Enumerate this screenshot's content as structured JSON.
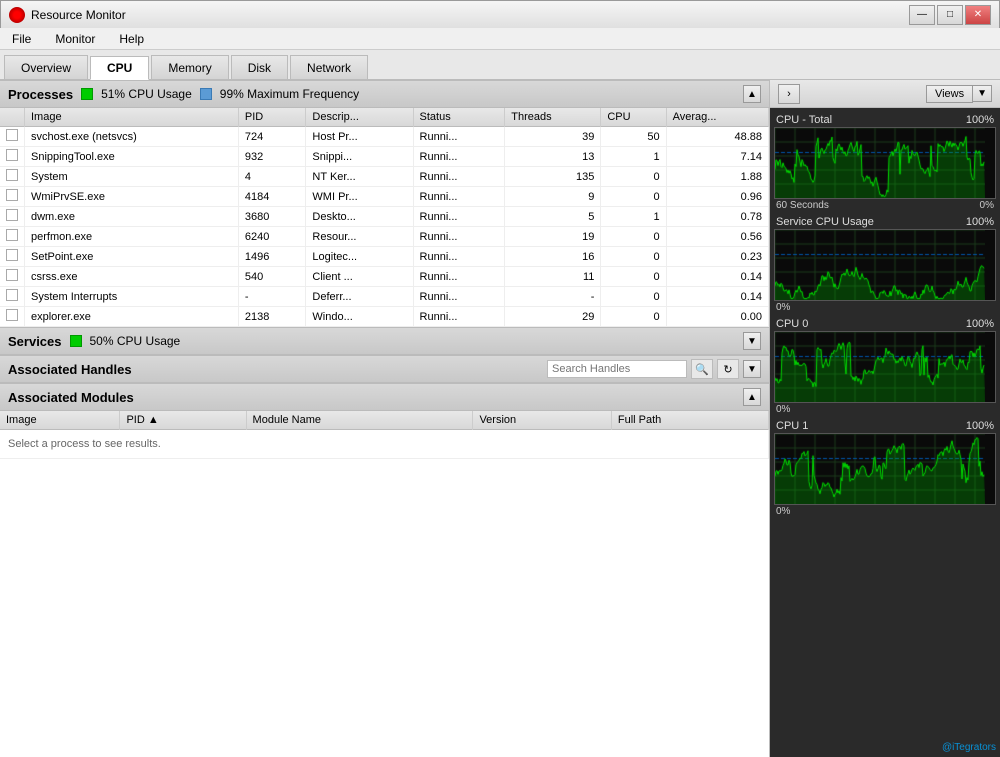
{
  "titleBar": {
    "icon": "resource-monitor-icon",
    "title": "Resource Monitor",
    "minBtn": "—",
    "maxBtn": "□",
    "closeBtn": "✕"
  },
  "menuBar": {
    "items": [
      "File",
      "Monitor",
      "Help"
    ]
  },
  "tabs": [
    {
      "label": "Overview",
      "active": false
    },
    {
      "label": "CPU",
      "active": true
    },
    {
      "label": "Memory",
      "active": false
    },
    {
      "label": "Disk",
      "active": false
    },
    {
      "label": "Network",
      "active": false
    }
  ],
  "processes": {
    "sectionTitle": "Processes",
    "cpuUsage": "51% CPU Usage",
    "maxFreq": "99% Maximum Frequency",
    "columns": [
      "Image",
      "PID",
      "Descrip...",
      "Status",
      "Threads",
      "CPU",
      "Averag..."
    ],
    "rows": [
      {
        "image": "svchost.exe (netsvcs)",
        "pid": "724",
        "desc": "Host Pr...",
        "status": "Runni...",
        "threads": "39",
        "cpu": "50",
        "avg": "48.88"
      },
      {
        "image": "SnippingTool.exe",
        "pid": "932",
        "desc": "Snippi...",
        "status": "Runni...",
        "threads": "13",
        "cpu": "1",
        "avg": "7.14"
      },
      {
        "image": "System",
        "pid": "4",
        "desc": "NT Ker...",
        "status": "Runni...",
        "threads": "135",
        "cpu": "0",
        "avg": "1.88"
      },
      {
        "image": "WmiPrvSE.exe",
        "pid": "4184",
        "desc": "WMI Pr...",
        "status": "Runni...",
        "threads": "9",
        "cpu": "0",
        "avg": "0.96"
      },
      {
        "image": "dwm.exe",
        "pid": "3680",
        "desc": "Deskto...",
        "status": "Runni...",
        "threads": "5",
        "cpu": "1",
        "avg": "0.78"
      },
      {
        "image": "perfmon.exe",
        "pid": "6240",
        "desc": "Resour...",
        "status": "Runni...",
        "threads": "19",
        "cpu": "0",
        "avg": "0.56"
      },
      {
        "image": "SetPoint.exe",
        "pid": "1496",
        "desc": "Logitec...",
        "status": "Runni...",
        "threads": "16",
        "cpu": "0",
        "avg": "0.23"
      },
      {
        "image": "csrss.exe",
        "pid": "540",
        "desc": "Client ...",
        "status": "Runni...",
        "threads": "11",
        "cpu": "0",
        "avg": "0.14"
      },
      {
        "image": "System Interrupts",
        "pid": "-",
        "desc": "Deferr...",
        "status": "Runni...",
        "threads": "-",
        "cpu": "0",
        "avg": "0.14"
      },
      {
        "image": "explorer.exe",
        "pid": "2138",
        "desc": "Windo...",
        "status": "Runni...",
        "threads": "29",
        "cpu": "0",
        "avg": "0.00"
      }
    ]
  },
  "services": {
    "sectionTitle": "Services",
    "cpuUsage": "50% CPU Usage"
  },
  "handles": {
    "sectionTitle": "Associated Handles",
    "searchPlaceholder": "Search Handles"
  },
  "modules": {
    "sectionTitle": "Associated Modules",
    "columns": [
      "Image",
      "PID",
      "Module Name",
      "Version",
      "Full Path"
    ],
    "emptyMessage": "Select a process to see results."
  },
  "rightPanel": {
    "navBtn": "›",
    "viewsLabel": "Views",
    "graphs": [
      {
        "label": "CPU - Total",
        "pct100": "100%",
        "footer60sec": "60 Seconds",
        "footerVal": "0%"
      },
      {
        "label": "Service CPU Usage",
        "pct100": "100%",
        "footerVal": "0%"
      },
      {
        "label": "CPU 0",
        "pct100": "100%",
        "footerVal": "0%"
      },
      {
        "label": "CPU 1",
        "pct100": "100%",
        "footerVal": "0%"
      }
    ]
  },
  "watermark": "@iTegrators"
}
